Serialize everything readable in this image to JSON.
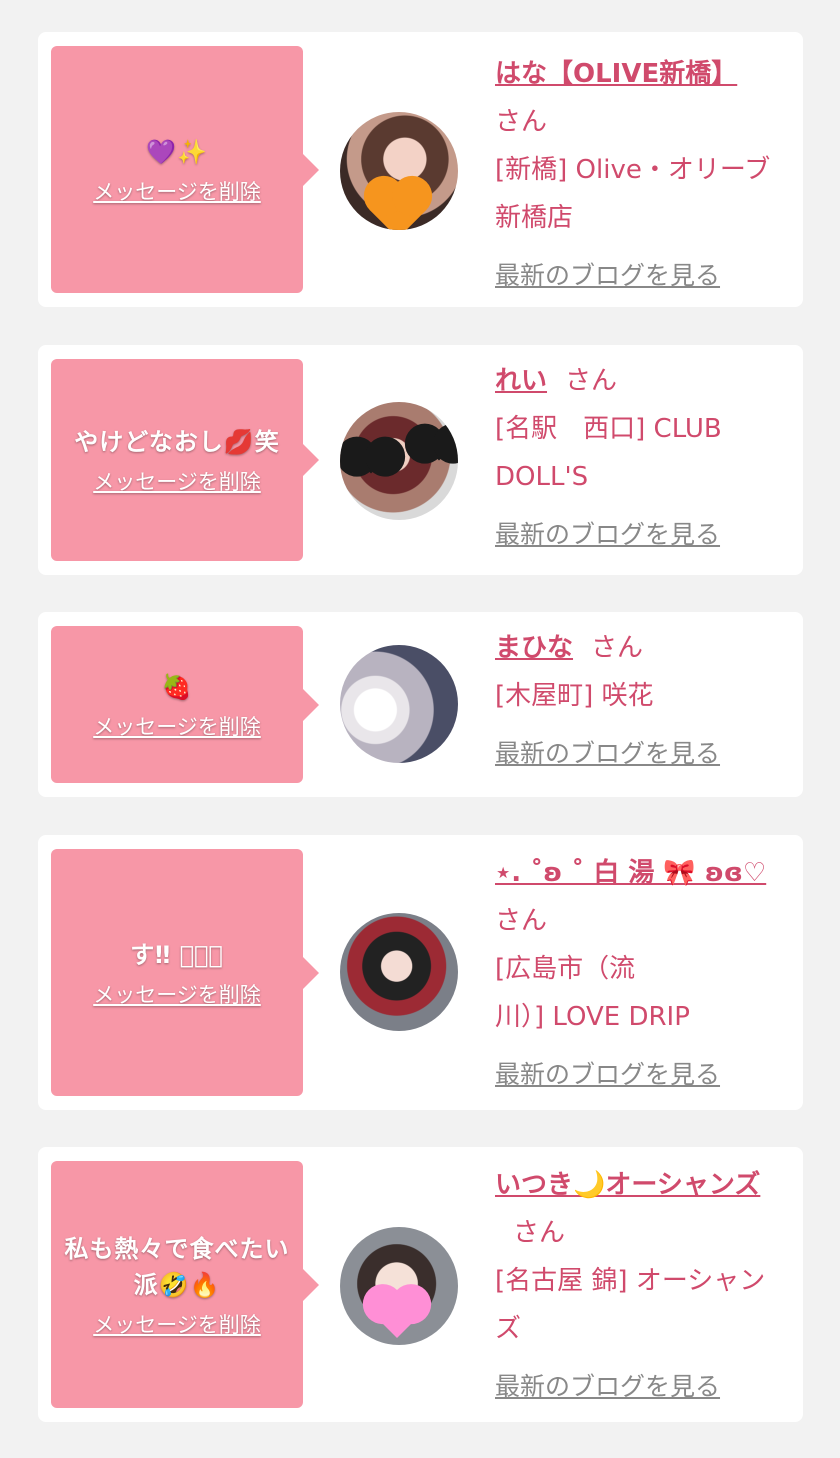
{
  "delete_label": "メッセージを削除",
  "blog_label": "最新のブログを見る",
  "san_label": "さん",
  "colors": {
    "accent": "#d04a6c",
    "bubble": "#f797a7",
    "background": "#f2f2f2"
  },
  "items": [
    {
      "message": "💜✨",
      "name": "はな【OLIVE新橋】",
      "shop_lines": [
        "[新橋] Olive・オリーブ",
        "新橋店"
      ]
    },
    {
      "message": "やけどなおし💋笑",
      "name": "れい",
      "shop_lines": [
        "[名駅　西口] CLUB",
        "DOLL'S"
      ]
    },
    {
      "message": "🍓",
      "name": "まひな",
      "shop_lines": [
        "[木屋町] 咲花"
      ]
    },
    {
      "message": "す‼︎ ⃝⃝⃝",
      "name": "⋆. ˚ʚ ˚ 白 湯 🎀 ʚɞ♡",
      "shop_lines": [
        "[広島市（流",
        "川）] LOVE DRIP"
      ]
    },
    {
      "message": "私も熱々で食べたい派🤣🔥",
      "name": "いつき🌙オーシャンズ",
      "shop_lines": [
        "[名古屋 錦] オーシャン",
        "ズ"
      ]
    }
  ]
}
